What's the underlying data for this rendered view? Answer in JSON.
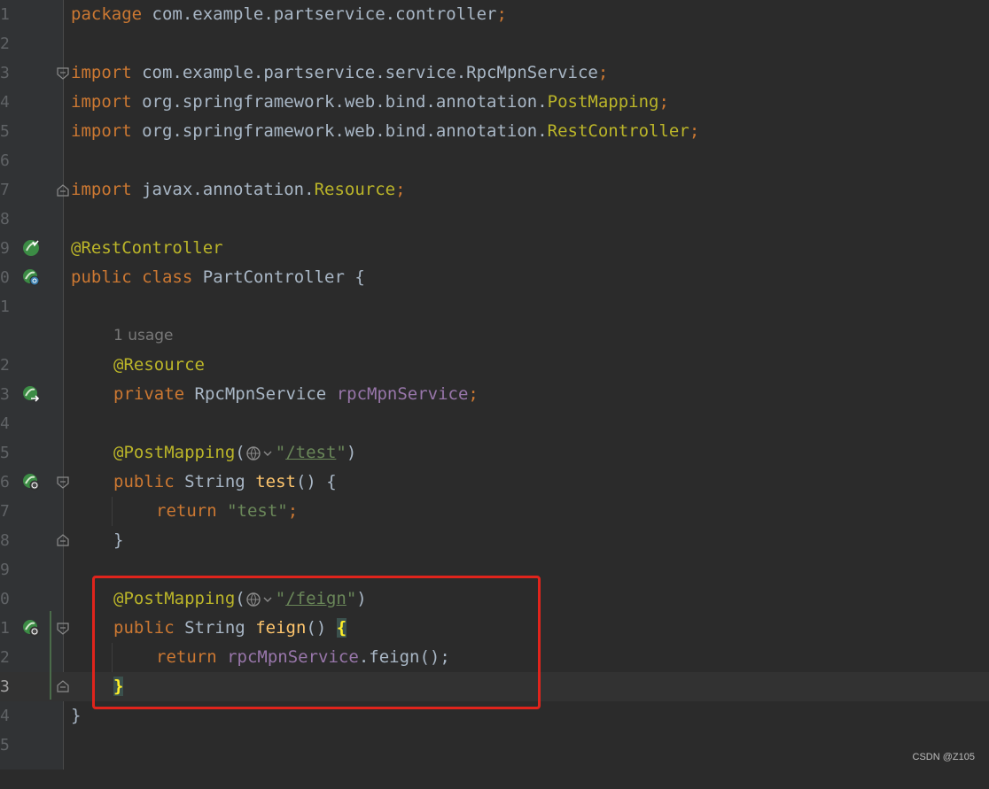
{
  "gutter": {
    "line_numbers": [
      "1",
      "2",
      "3",
      "4",
      "5",
      "6",
      "7",
      "8",
      "9",
      "0",
      "1",
      "",
      "2",
      "3",
      "4",
      "5",
      "6",
      "7",
      "8",
      "9",
      "0",
      "1",
      "2",
      "3",
      "4",
      "5"
    ]
  },
  "code": {
    "package_kw": "package",
    "package_name": "com.example.partservice.controller",
    "semicolon": ";",
    "import_kw": "import",
    "import1_pkg": "com.example.partservice.service.RpcMpnService",
    "import2_pkg": "org.springframework.web.bind.annotation.",
    "import2_cls": "PostMapping",
    "import3_pkg": "org.springframework.web.bind.annotation.",
    "import3_cls": "RestController",
    "import4_pkg": "javax.annotation.",
    "import4_cls": "Resource",
    "rest_controller_ann": "@RestController",
    "public_kw": "public",
    "class_kw": "class",
    "class_name": "PartController",
    "open_brace": "{",
    "close_brace": "}",
    "usage_hint": "1 usage",
    "resource_ann": "@Resource",
    "private_kw": "private",
    "field_type": "RpcMpnService",
    "field_name": "rpcMpnService",
    "post_mapping_ann": "@PostMapping",
    "paren_open": "(",
    "paren_close": ")",
    "quote": "\"",
    "test_url": "/test",
    "string_type": "String",
    "test_method": "test",
    "empty_parens": "()",
    "return_kw": "return",
    "test_string": "\"test\"",
    "feign_url": "/feign",
    "feign_method": "feign",
    "feign_call": ".feign();"
  },
  "watermark": "CSDN @Z105",
  "colors": {
    "background": "#2b2b2b",
    "gutter": "#313335",
    "keyword": "#cc7832",
    "annotation": "#bbb529",
    "field": "#9876aa",
    "string": "#6a8759",
    "method": "#ffc66d",
    "highlight_box": "#e0241c"
  }
}
